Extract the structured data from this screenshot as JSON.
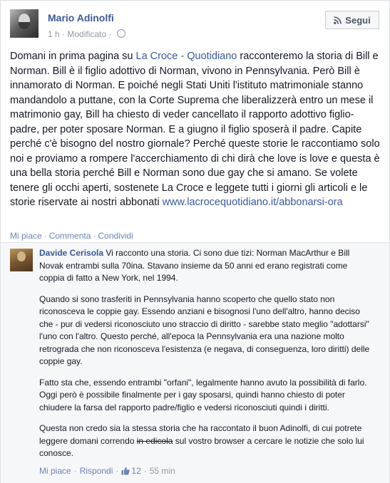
{
  "post": {
    "author": "Mario Adinolfi",
    "time": "1 h",
    "edited": "Modificato",
    "follow_label": "Segui",
    "body_before_link": "Domani in prima pagina su ",
    "link_text": "La Croce - Quotidiano",
    "body_after_link": " racconteremo la storia di Bill e Norman. Bill è il figlio adottivo di Norman, vivono in Pennsylvania. Però Bill è innamorato di Norman. E poiché negli Stati Uniti l'istituto matrimoniale stanno mandandolo a puttane, con la Corte Suprema che liberalizzerà entro un mese il matrimonio gay, Bill ha chiesto di veder cancellato il rapporto adottivo figlio-padre, per poter sposare Norman. E a giugno il figlio sposerà il padre. Capite perché c'è bisogno del nostro giornale? Perché queste storie le raccontiamo solo noi e proviamo a rompere l'accerchiamento di chi dirà che love is love e questa è una bella storia perché Bill e Norman sono due gay che si amano. Se volete tenere gli occhi aperti, sostenete La Croce e leggete tutti i giorni gli articoli e le storie riservate ai nostri abbonati ",
    "url_text": "www.lacrocequotidiano.it/abbonarsi-ora",
    "actions": [
      "Mi piace",
      "Commenta",
      "Condividi"
    ]
  },
  "comment": {
    "author": "Davide Cerisola",
    "p1": " Vi racconto una storia. Ci sono due tizi: Norman MacArthur e Bill Novak entrambi sulla 70ina. Stavano insieme da 50 anni ed erano registrati come coppia di fatto a New York, nel 1994.",
    "p2": "Quando si sono trasferiti in Pennsylvania hanno scoperto che quello stato non riconosceva le coppie gay. Essendo anziani e bisognosi l'uno dell'altro, hanno deciso che - pur di vedersi riconosciuto uno straccio di diritto - sarebbe stato meglio \"adottarsi\" l'uno con l'altro. Questo perché, all'epoca la Pennsylvania era una nazione molto retrograda che non riconosceva l'esistenza (e negava, di conseguenza, loro diritti) delle coppie gay.",
    "p3": "Fatto sta che, essendo entrambi \"orfani\", legalmente hanno avuto la possibilità di farlo. Oggi però è possibile finalmente per i gay sposarsi, quindi hanno chiesto di poter chiudere la farsa del rapporto padre/figlio e vedersi riconosciuti quindi i diritti.",
    "p4_before": "Questa non credo sia la stessa storia che ha raccontato il buon Adinolfi, di cui potrete leggere domani correndo ",
    "p4_strike": "in edicola",
    "p4_after": " sul vostro browser a cercare le notizie che solo lui conosce.",
    "like_label": "Mi piace",
    "reply_label": "Rispondi",
    "like_count": "12",
    "time": "55 min"
  }
}
